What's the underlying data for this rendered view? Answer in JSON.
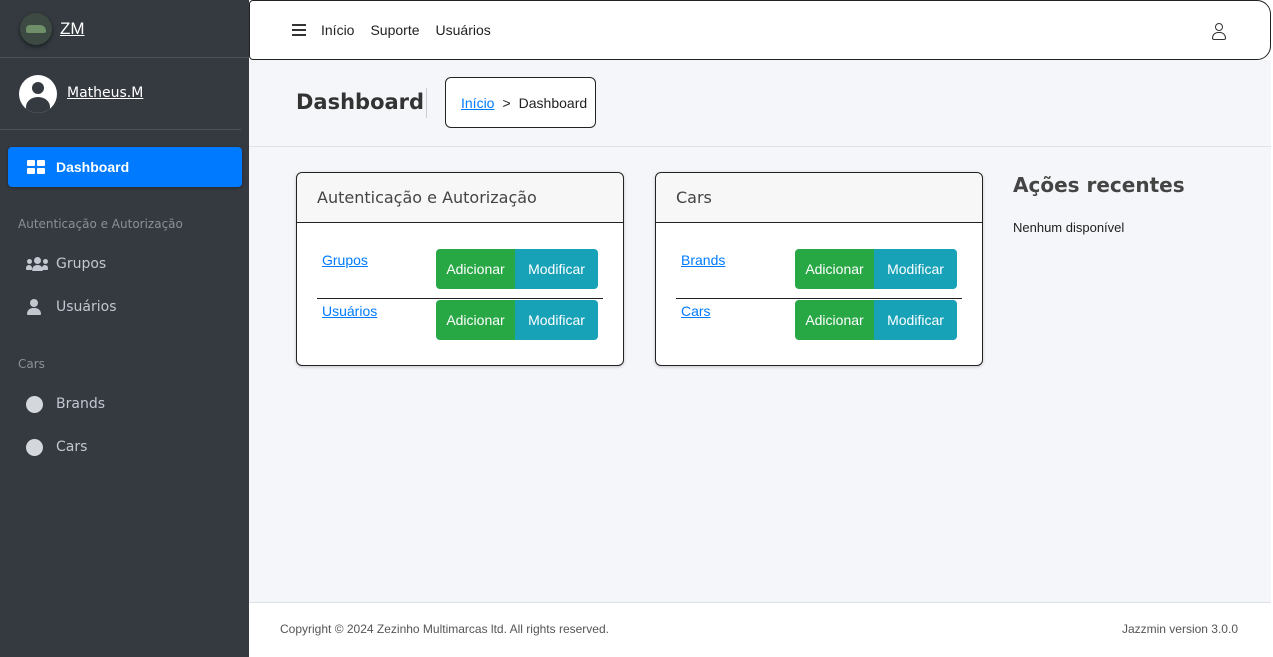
{
  "brand": {
    "name": "ZM",
    "logo_icon": "car-logo-icon"
  },
  "user": {
    "name": "Matheus.M",
    "avatar_icon": "user-circle-icon"
  },
  "sidebar": {
    "active_item": {
      "label": "Dashboard",
      "icon": "grid-icon"
    },
    "sections": [
      {
        "header": "Autenticação e Autorização",
        "items": [
          {
            "label": "Grupos",
            "icon": "users-icon"
          },
          {
            "label": "Usuários",
            "icon": "user-icon"
          }
        ]
      },
      {
        "header": "Cars",
        "items": [
          {
            "label": "Brands",
            "icon": "circle-icon"
          },
          {
            "label": "Cars",
            "icon": "circle-icon"
          }
        ]
      }
    ]
  },
  "topbar": {
    "menu_icon": "hamburger-icon",
    "links": [
      "Início",
      "Suporte",
      "Usuários"
    ],
    "user_icon": "user-outline-icon"
  },
  "header": {
    "title": "Dashboard",
    "breadcrumb": {
      "home": "Início",
      "separator": ">",
      "current": "Dashboard"
    }
  },
  "apps": [
    {
      "title": "Autenticação e Autorização",
      "models": [
        {
          "name": "Grupos",
          "add_label": "Adicionar",
          "change_label": "Modificar"
        },
        {
          "name": "Usuários",
          "add_label": "Adicionar",
          "change_label": "Modificar"
        }
      ]
    },
    {
      "title": "Cars",
      "models": [
        {
          "name": "Brands",
          "add_label": "Adicionar",
          "change_label": "Modificar"
        },
        {
          "name": "Cars",
          "add_label": "Adicionar",
          "change_label": "Modificar"
        }
      ]
    }
  ],
  "recent_actions": {
    "title": "Ações recentes",
    "empty_text": "Nenhum disponível"
  },
  "footer": {
    "copyright": "Copyright © 2024 Zezinho Multimarcas ltd. All rights reserved.",
    "version": "Jazzmin version 3.0.0"
  },
  "colors": {
    "sidebar_bg": "#343a40",
    "primary": "#007bff",
    "success": "#28a745",
    "info": "#17a2b8",
    "content_bg": "#f4f6f9"
  }
}
